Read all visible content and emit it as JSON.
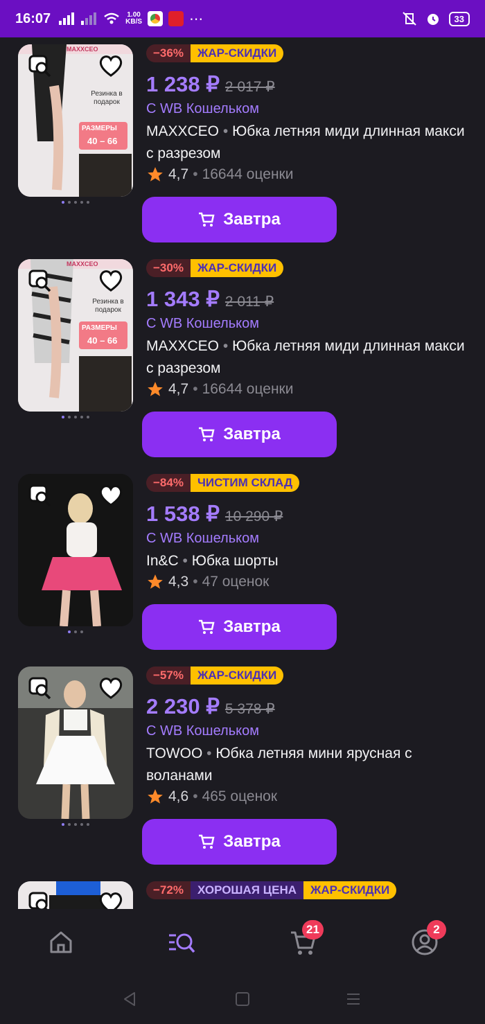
{
  "status_bar": {
    "time": "16:07",
    "net_speed_value": "1.00",
    "net_speed_unit": "KB/S",
    "battery": "33"
  },
  "products": [
    {
      "discount": "−36%",
      "badges": [
        "ЖАР-СКИДКИ"
      ],
      "price": "1 238 ₽",
      "old_price": "2 017 ₽",
      "wallet_note": "С WB Кошельком",
      "brand": "MAXXCEO",
      "name": "Юбка летняя миди длинная макси с разрезом",
      "rating": "4,7",
      "reviews": "16644 оценки",
      "button": "Завтра",
      "photo_texts": [
        "MAXXCEO",
        "Резинка в подарок",
        "РАЗМЕРЫ",
        "40 – 66"
      ]
    },
    {
      "discount": "−30%",
      "badges": [
        "ЖАР-СКИДКИ"
      ],
      "price": "1 343 ₽",
      "old_price": "2 011 ₽",
      "wallet_note": "С WB Кошельком",
      "brand": "MAXXCEO",
      "name": "Юбка летняя миди длинная макси с разрезом",
      "rating": "4,7",
      "reviews": "16644 оценки",
      "button": "Завтра",
      "photo_texts": [
        "MAXXCEO",
        "Резинка в подарок",
        "РАЗМЕРЫ",
        "40 – 66"
      ]
    },
    {
      "discount": "−84%",
      "badges": [
        "ЧИСТИМ СКЛАД"
      ],
      "price": "1 538 ₽",
      "old_price": "10 290 ₽",
      "wallet_note": "С WB Кошельком",
      "brand": "In&C",
      "name": "Юбка шорты",
      "rating": "4,3",
      "reviews": "47 оценок",
      "button": "Завтра"
    },
    {
      "discount": "−57%",
      "badges": [
        "ЖАР-СКИДКИ"
      ],
      "price": "2 230 ₽",
      "old_price": "5 378 ₽",
      "wallet_note": "С WB Кошельком",
      "brand": "TOWOO",
      "name": "Юбка летняя мини ярусная с воланами",
      "rating": "4,6",
      "reviews": "465 оценок",
      "button": "Завтра"
    },
    {
      "discount": "−72%",
      "badges": [
        "ХОРОШАЯ ЦЕНА",
        "ЖАР-СКИДКИ"
      ]
    }
  ],
  "nav": {
    "cart_count": "21",
    "profile_count": "2"
  },
  "colors": {
    "accent": "#8b2ff2",
    "price": "#a47cff",
    "status_bar": "#6b0fc2",
    "background": "#1c1b21",
    "hot_badge": "#ffc000",
    "badge_red": "#ef3b5a"
  },
  "icons": [
    "visual-search-icon",
    "heart-icon",
    "cart-icon",
    "star-icon",
    "home-icon",
    "catalog-search-icon",
    "profile-icon"
  ]
}
